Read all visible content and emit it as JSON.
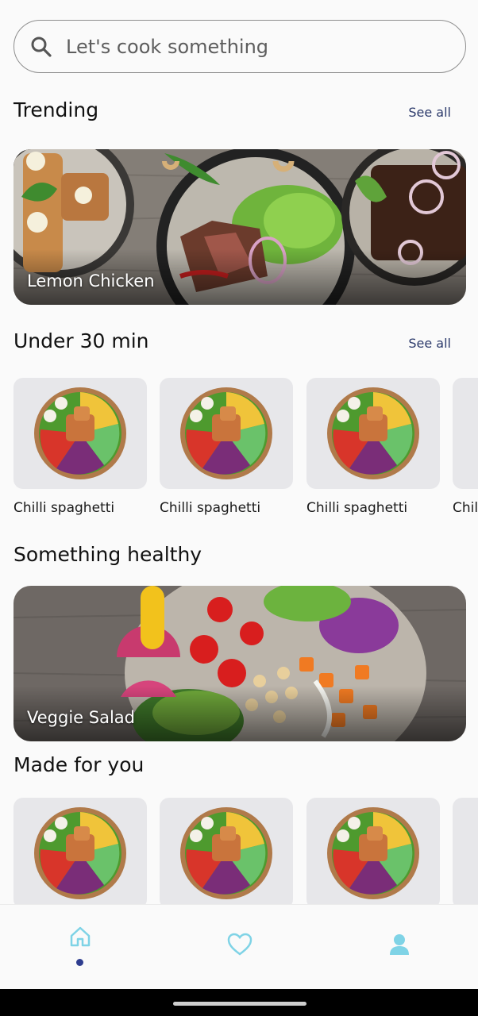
{
  "search": {
    "placeholder": "Let's cook something"
  },
  "sections": {
    "trending": {
      "title": "Trending",
      "see_all": "See all",
      "hero_caption": "Lemon Chicken"
    },
    "under30": {
      "title": "Under 30 min",
      "see_all": "See all",
      "items": [
        "Chilli spaghetti",
        "Chilli spaghetti",
        "Chilli spaghetti",
        "Chilli spaghetti"
      ]
    },
    "healthy": {
      "title": "Something healthy",
      "hero_caption": "Veggie Salad"
    },
    "made_for_you": {
      "title": "Made for you"
    }
  },
  "nav": {
    "icons": [
      "home-icon",
      "heart-icon",
      "profile-icon"
    ],
    "active": "home",
    "accent": "#7fd3e6",
    "dot_color": "#2e3d8f"
  },
  "colors": {
    "background": "#fafafa",
    "link": "#2c3a6b"
  }
}
